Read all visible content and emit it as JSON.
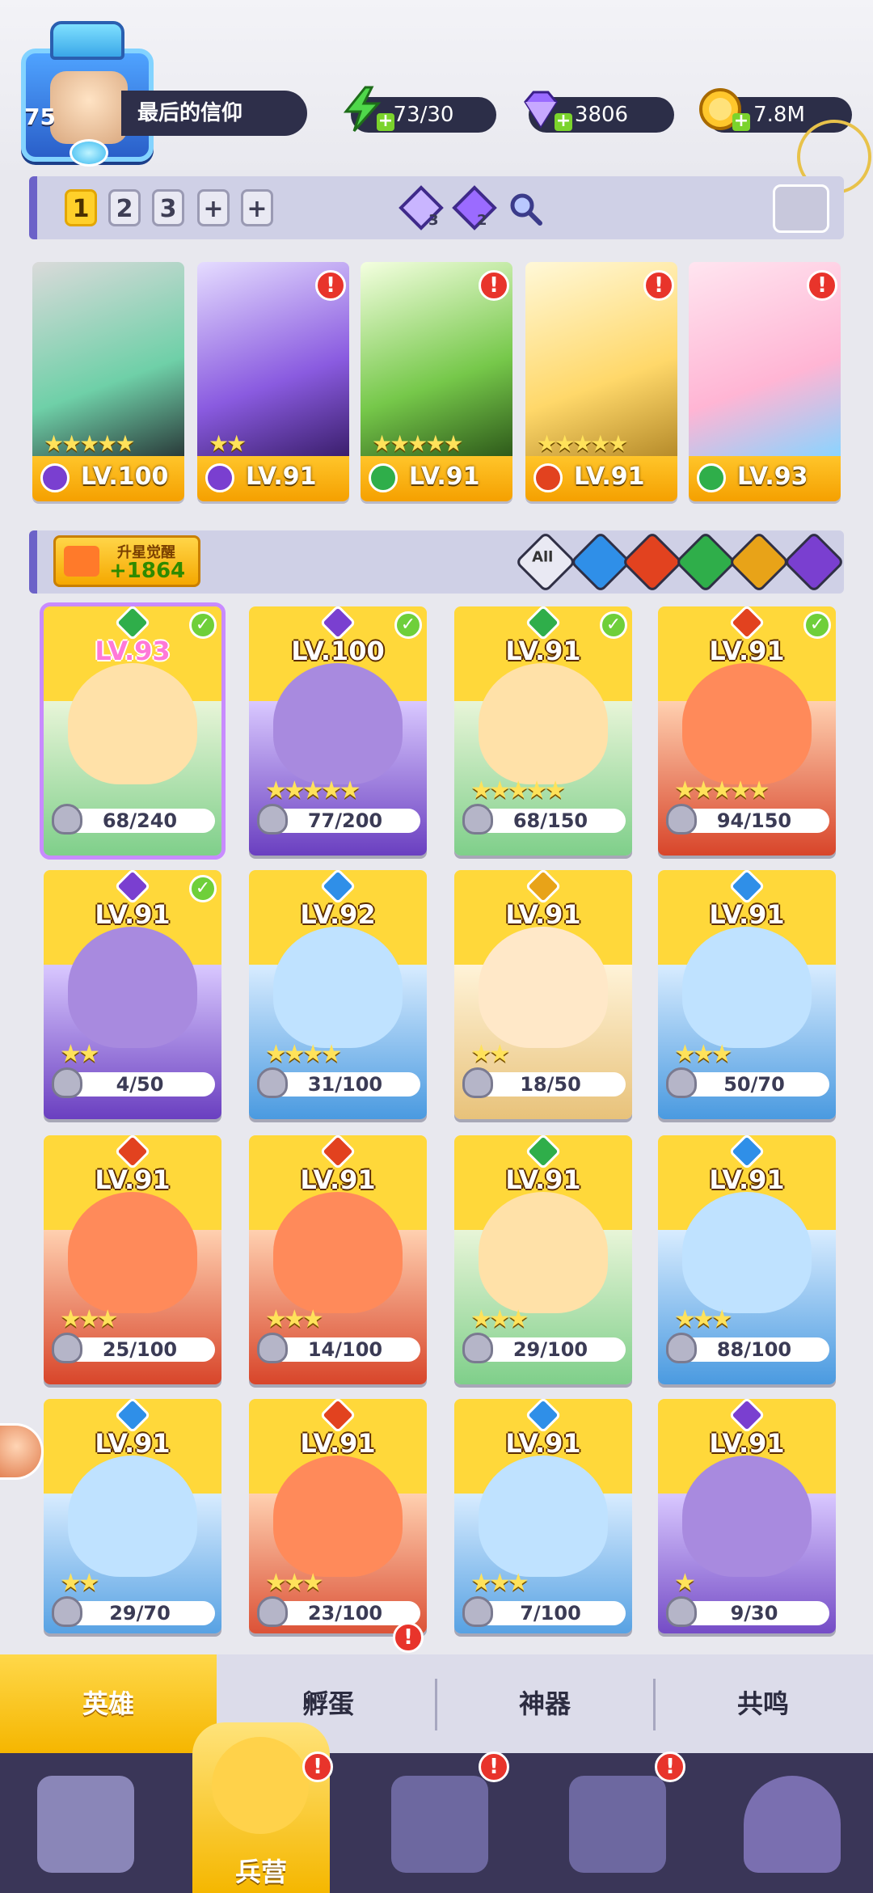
{
  "header": {
    "player_level": "75",
    "player_name": "最后的信仰",
    "energy": "73/30",
    "gems": "3806",
    "gold": "7.8M"
  },
  "team_bar": {
    "slots": [
      "1",
      "2",
      "3",
      "+",
      "+"
    ],
    "rune_a_count": "3",
    "rune_b_count": "2"
  },
  "team_heroes": [
    {
      "level": "LV.100",
      "stars": "★★★★★",
      "element": "dark",
      "alert": ""
    },
    {
      "level": "LV.91",
      "stars": "★★",
      "element": "dark",
      "alert": "!"
    },
    {
      "level": "LV.91",
      "stars": "★★★★★",
      "element": "nature",
      "alert": "!"
    },
    {
      "level": "LV.91",
      "stars": "★★★★★",
      "element": "fire",
      "alert": "!"
    },
    {
      "level": "LV.93",
      "stars": "",
      "element": "nature",
      "alert": "!"
    }
  ],
  "filter_bar": {
    "upgrade_title": "升星觉醒",
    "upgrade_value": "+1864",
    "all_label": "All",
    "filters": [
      "water",
      "fire",
      "nature",
      "light",
      "dark"
    ]
  },
  "heroes": [
    {
      "level": "LV.93",
      "fragments": "68/240",
      "stars": "",
      "checked": "✓",
      "element": "nature"
    },
    {
      "level": "LV.100",
      "fragments": "77/200",
      "stars": "★★★★★",
      "checked": "✓",
      "element": "dark"
    },
    {
      "level": "LV.91",
      "fragments": "68/150",
      "stars": "★★★★★",
      "checked": "✓",
      "element": "nature"
    },
    {
      "level": "LV.91",
      "fragments": "94/150",
      "stars": "★★★★★",
      "checked": "✓",
      "element": "fire"
    },
    {
      "level": "LV.91",
      "fragments": "4/50",
      "stars": "★★",
      "checked": "✓",
      "element": "dark"
    },
    {
      "level": "LV.92",
      "fragments": "31/100",
      "stars": "★★★★",
      "checked": "",
      "element": "water"
    },
    {
      "level": "LV.91",
      "fragments": "18/50",
      "stars": "★★",
      "checked": "",
      "element": "light"
    },
    {
      "level": "LV.91",
      "fragments": "50/70",
      "stars": "★★★",
      "checked": "",
      "element": "water"
    },
    {
      "level": "LV.91",
      "fragments": "25/100",
      "stars": "★★★",
      "checked": "",
      "element": "fire"
    },
    {
      "level": "LV.91",
      "fragments": "14/100",
      "stars": "★★★",
      "checked": "",
      "element": "fire"
    },
    {
      "level": "LV.91",
      "fragments": "29/100",
      "stars": "★★★",
      "checked": "",
      "element": "nature"
    },
    {
      "level": "LV.91",
      "fragments": "88/100",
      "stars": "★★★",
      "checked": "",
      "element": "water"
    },
    {
      "level": "LV.91",
      "fragments": "29/70",
      "stars": "★★",
      "checked": "",
      "element": "water"
    },
    {
      "level": "LV.91",
      "fragments": "23/100",
      "stars": "★★★",
      "checked": "",
      "element": "fire"
    },
    {
      "level": "LV.91",
      "fragments": "7/100",
      "stars": "★★★",
      "checked": "",
      "element": "water"
    },
    {
      "level": "LV.91",
      "fragments": "9/30",
      "stars": "★",
      "checked": "",
      "element": "dark"
    }
  ],
  "tabs": [
    {
      "label": "英雄",
      "active": true,
      "alert": ""
    },
    {
      "label": "孵蛋",
      "active": false,
      "alert": "!"
    },
    {
      "label": "神器",
      "active": false,
      "alert": ""
    },
    {
      "label": "共鸣",
      "active": false,
      "alert": ""
    }
  ],
  "bottom_nav": {
    "active_label": "兵营",
    "alert": "!"
  },
  "colors": {
    "water": "#2f8fe8",
    "fire": "#e2421f",
    "nature": "#2fae4a",
    "light": "#e8a318",
    "dark": "#7a3fd0",
    "accent": "#ffc52a"
  }
}
